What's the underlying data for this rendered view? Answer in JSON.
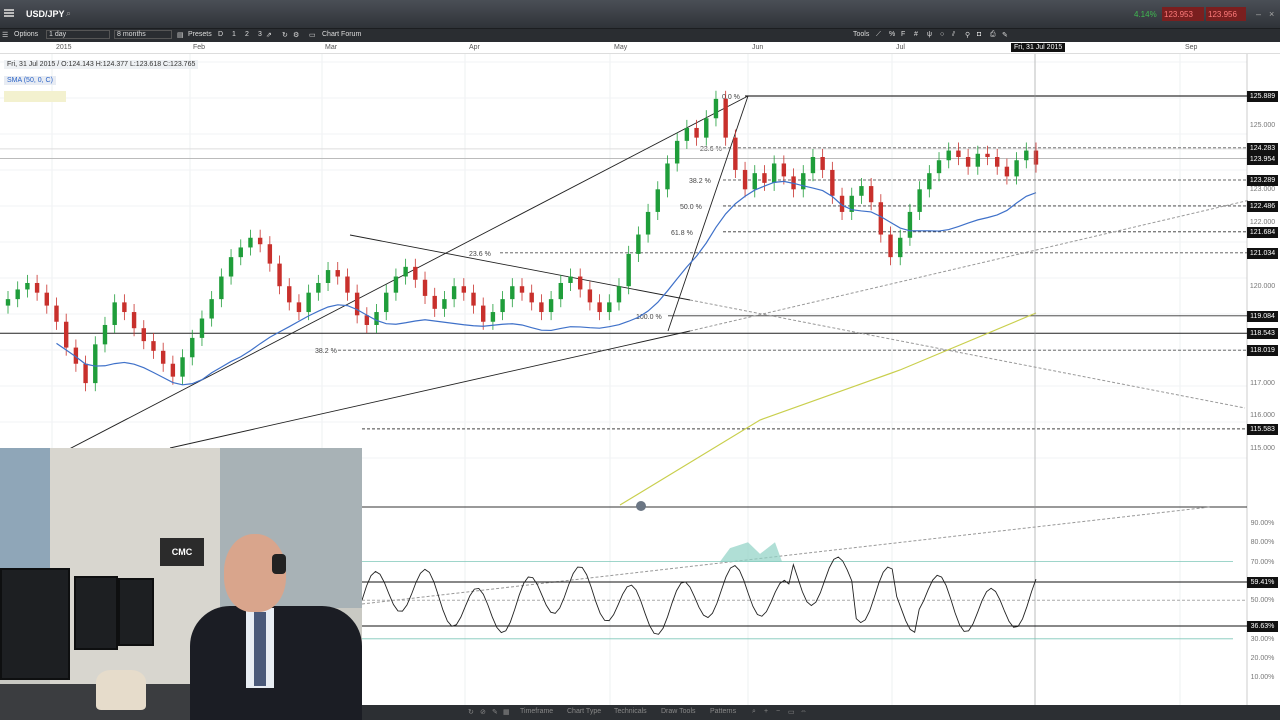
{
  "app": {
    "symbol": "USD/JPY",
    "stat_pct": "4.14%",
    "bid": "123.953",
    "ask": "123.956"
  },
  "toolbar": {
    "options_label": "Options",
    "interval": "1 day",
    "range": "8 months",
    "presets_label": "Presets",
    "preset_buttons": [
      "D",
      "1",
      "2",
      "3"
    ],
    "chart_forum_label": "Chart Forum",
    "tools_label": "Tools"
  },
  "time_axis": {
    "labels": [
      "2015",
      "Feb",
      "Mar",
      "Apr",
      "May",
      "Jun",
      "Jul",
      "Sep"
    ],
    "cursor_date": "Fri, 31 Jul 2015"
  },
  "legend": {
    "ohlc": "Fri, 31 Jul 2015 / O:124.143  H:124.377  L:123.618  C:123.765",
    "sma": "SMA (50, 0, C)"
  },
  "price_axis": {
    "highlighted": [
      "125.889",
      "124.283",
      "123.954",
      "123.289",
      "122.486",
      "121.684",
      "121.034",
      "119.084",
      "118.543",
      "118.019",
      "115.583"
    ],
    "ticks": [
      "125.000",
      "123.000",
      "122.000",
      "120.000",
      "117.000",
      "116.000",
      "115.000"
    ]
  },
  "rsi_axis": {
    "highlighted": [
      "59.41%",
      "36.63%"
    ],
    "ticks": [
      "90.00%",
      "80.00%",
      "70.00%",
      "50.00%",
      "30.00%",
      "20.00%",
      "10.00%"
    ]
  },
  "fib_labels": {
    "fib1": [
      "0.0 %",
      "23.6 %",
      "38.2 %",
      "50.0 %",
      "61.8 %",
      "100.0 %"
    ],
    "fib2": [
      "23.6 %",
      "38.2 %"
    ]
  },
  "bottom_bar": {
    "items": [
      "Timeframe",
      "Chart Type",
      "Technicals",
      "Draw Tools",
      "Patterns"
    ]
  },
  "webcam": {
    "logo_text": "CMC"
  },
  "colors": {
    "up": "#1f9d3a",
    "down": "#c8302c",
    "sma50": "#3f71c9",
    "sma_long": "#c9cf4d",
    "rsi_overbought": "#8fd1c4"
  },
  "chart_data": {
    "type": "candlestick",
    "instrument": "USD/JPY",
    "timeframe": "1 day",
    "last_bar": {
      "date": "Fri, 31 Jul 2015",
      "open": 124.143,
      "high": 124.377,
      "low": 123.618,
      "close": 123.765
    },
    "y_range": [
      114.5,
      126.5
    ],
    "close_series": [
      119.6,
      119.9,
      120.1,
      119.8,
      119.4,
      118.9,
      118.1,
      117.6,
      117.0,
      118.2,
      118.8,
      119.5,
      119.2,
      118.7,
      118.3,
      118.0,
      117.6,
      117.2,
      117.8,
      118.4,
      119.0,
      119.6,
      120.3,
      120.9,
      121.2,
      121.5,
      121.3,
      120.7,
      120.0,
      119.5,
      119.2,
      119.8,
      120.1,
      120.5,
      120.3,
      119.8,
      119.1,
      118.8,
      119.2,
      119.8,
      120.3,
      120.6,
      120.2,
      119.7,
      119.3,
      119.6,
      120.0,
      119.8,
      119.4,
      118.9,
      119.2,
      119.6,
      120.0,
      119.8,
      119.5,
      119.2,
      119.6,
      120.1,
      120.3,
      119.9,
      119.5,
      119.2,
      119.5,
      120.0,
      121.0,
      121.6,
      122.3,
      123.0,
      123.8,
      124.5,
      124.9,
      124.6,
      125.2,
      125.8,
      124.6,
      123.6,
      123.0,
      123.5,
      123.2,
      123.8,
      123.4,
      123.0,
      123.5,
      124.0,
      123.6,
      122.8,
      122.3,
      122.8,
      123.1,
      122.6,
      121.6,
      120.9,
      121.5,
      122.3,
      123.0,
      123.5,
      123.9,
      124.2,
      124.0,
      123.7,
      124.1,
      124.0,
      123.7,
      123.4,
      123.9,
      124.2,
      123.765
    ],
    "fibonacci_1": {
      "0.0": 125.889,
      "23.6": 124.283,
      "38.2": 123.289,
      "50.0": 122.486,
      "61.8": 121.684,
      "100.0": 119.084
    },
    "fibonacci_2_levels": {
      "23.6": 121.034,
      "38.2": 118.019
    },
    "horizontal_levels": [
      118.543,
      115.583
    ],
    "current_price": 123.954,
    "rsi": {
      "levels": [
        70,
        59.41,
        36.63
      ],
      "y_range": [
        0,
        100
      ]
    }
  }
}
